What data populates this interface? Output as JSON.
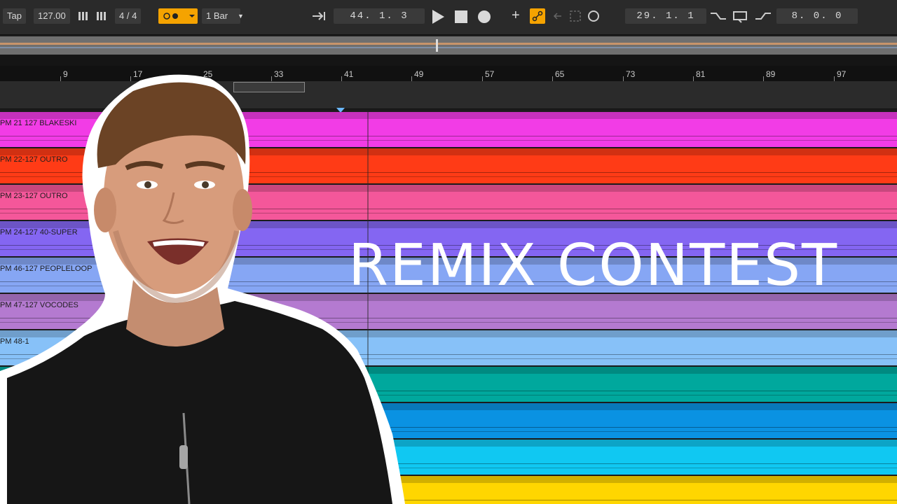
{
  "transport": {
    "tap_label": "Tap",
    "tempo": "127.00",
    "time_signature": "4 / 4",
    "quantize": "1 Bar",
    "arrangement_position": "44. 1. 3",
    "loop_start": "29. 1. 1",
    "loop_length": "8. 0. 0",
    "accent_color": "#f5a300"
  },
  "ruler": {
    "bars": [
      {
        "label": "9"
      },
      {
        "label": "17"
      },
      {
        "label": "25"
      },
      {
        "label": "33"
      },
      {
        "label": "41"
      },
      {
        "label": "49"
      },
      {
        "label": "57"
      },
      {
        "label": "65"
      },
      {
        "label": "73"
      },
      {
        "label": "81"
      },
      {
        "label": "89"
      },
      {
        "label": "97"
      }
    ]
  },
  "tracks": [
    {
      "name": "PM 21 127 BLAKESKI",
      "color": "#f23ce6"
    },
    {
      "name": "PM 22-127 OUTRO",
      "color": "#ff3b16"
    },
    {
      "name": "PM 23-127 OUTRO",
      "color": "#f4579a"
    },
    {
      "name": "PM 24-127 40-SUPER",
      "color": "#8466f2"
    },
    {
      "name": "PM 46-127 PEOPLELOOP",
      "color": "#86a6f4"
    },
    {
      "name": "PM 47-127 VOCODES",
      "color": "#b47ad0"
    },
    {
      "name": "PM 48-1",
      "color": "#87c1f8"
    },
    {
      "name": "",
      "color": "#00a89d"
    },
    {
      "name": "",
      "color": "#0a92e2"
    },
    {
      "name": "",
      "color": "#10c8f2"
    },
    {
      "name": "",
      "color": "#ffd600"
    }
  ],
  "overlay": {
    "headline": "REMIX CONTEST"
  }
}
